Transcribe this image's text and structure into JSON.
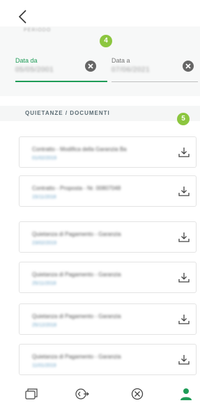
{
  "filters": {
    "cut_label": "PERIODO",
    "badge": "4",
    "from": {
      "label": "Data da",
      "value": "05/05/2001"
    },
    "to": {
      "label": "Data a",
      "value": "07/06/2021"
    }
  },
  "section": {
    "title": "QUIETANZE / DOCUMENTI",
    "badge": "5"
  },
  "documents": [
    {
      "title": "Contratto - Modifica della Garanzia Ba",
      "date": "01/02/2019"
    },
    {
      "title": "Contratto - Proposta - Nr. 00807048",
      "date": "15/11/2018"
    },
    {
      "title": "Quietanza di Pagamento - Garanzia",
      "date": "23/02/2019"
    },
    {
      "title": "Quietanza di Pagamento - Garanzia",
      "date": "25/11/2018"
    },
    {
      "title": "Quietanza di Pagamento - Garanzia",
      "date": "25/12/2018"
    },
    {
      "title": "Quietanza di Pagamento - Garanzia",
      "date": "11/01/2019"
    }
  ],
  "icons": {
    "back": "chevron-left-icon",
    "clear": "clear-circle-icon",
    "download": "download-icon",
    "tabs": [
      "cards-icon",
      "exchange-icon",
      "cancel-circle-icon",
      "user-icon"
    ]
  },
  "colors": {
    "accent": "#1e9c57",
    "badge": "#8cc63f",
    "date": "#6aa2c6"
  }
}
